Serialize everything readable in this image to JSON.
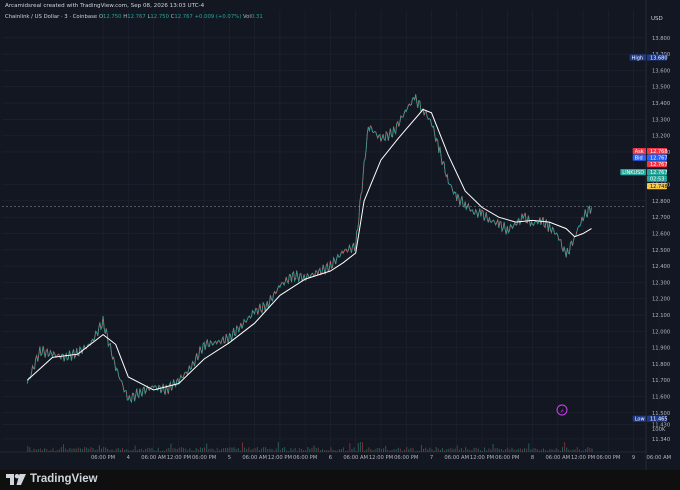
{
  "header": {
    "credit": "Arcamidsreal created with TradingView.com, Sep 08, 2026 13:03 UTC-4",
    "symbol_line": "Chainlink / US Dollar · 3 · Coinbase",
    "o_label": "O",
    "o_value": "12.750",
    "h_label": "H",
    "h_value": "12.767",
    "l_label": "L",
    "l_value": "12.750",
    "c_label": "C",
    "c_value": "12.767",
    "change": "+0.009 (+0.07%)",
    "vol_label": "Vol",
    "vol_value": "0.31"
  },
  "price_axis": {
    "currency": "USD",
    "ticks": [
      "13.800",
      "13.700",
      "13.600",
      "13.500",
      "13.400",
      "13.300",
      "13.200",
      "13.100",
      "12.900",
      "12.800",
      "12.700",
      "12.600",
      "12.500",
      "12.400",
      "12.300",
      "12.200",
      "12.100",
      "12.000",
      "11.900",
      "11.800",
      "11.700",
      "11.600",
      "11.500",
      "11.430",
      "11.340"
    ],
    "volume_label": "100K",
    "markers": [
      {
        "label": "High",
        "value": "13.680",
        "color": "#1e3a8a"
      },
      {
        "label": "Ask",
        "value": "12.768",
        "color": "#f23645"
      },
      {
        "label": "Bid",
        "value": "12.767",
        "color": "#2962ff"
      },
      {
        "label": "",
        "value": "12.767",
        "color": "#f23645"
      },
      {
        "label": "LINKUSD",
        "value": "12.767",
        "color": "#26a69a"
      },
      {
        "label": "",
        "value": "02:53",
        "color": "#26a69a"
      },
      {
        "label": "",
        "value": "12.748",
        "color": "#f7c948"
      },
      {
        "label": "Low",
        "value": "11.465",
        "color": "#1e3a8a"
      }
    ]
  },
  "time_axis": {
    "labels": [
      "06:00 PM",
      "4",
      "06:00 AM",
      "12:00 PM",
      "06:00 PM",
      "5",
      "06:00 AM",
      "12:00 PM",
      "06:00 PM",
      "6",
      "06:00 AM",
      "12:00 PM",
      "06:00 PM",
      "7",
      "06:00 AM",
      "12:00 PM",
      "06:00 PM",
      "8",
      "06:00 AM",
      "12:00 PM",
      "06:00 PM",
      "9",
      "06:00 AM"
    ]
  },
  "chart_data": {
    "type": "line",
    "title": "Chainlink / US Dollar · 3 · Coinbase",
    "ylim": [
      11.26,
      13.86
    ],
    "x_label_times": [
      18,
      24,
      30,
      36,
      42,
      48,
      54,
      60,
      66,
      72,
      78,
      84,
      90,
      96,
      102,
      108,
      114,
      120,
      126,
      132,
      138,
      144,
      150
    ],
    "price_series": {
      "name": "LINKUSD",
      "x_hours": [
        0,
        3,
        6,
        9,
        12,
        15,
        18,
        21,
        24,
        27,
        30,
        33,
        36,
        39,
        42,
        45,
        48,
        51,
        54,
        57,
        60,
        63,
        66,
        69,
        72,
        75,
        78,
        81,
        84,
        87,
        90,
        92,
        94,
        96,
        98,
        100,
        102,
        104,
        106,
        108,
        110,
        112,
        114,
        116,
        118,
        120,
        122,
        124,
        126,
        128,
        130,
        132,
        134
      ],
      "values": [
        11.68,
        11.88,
        11.86,
        11.84,
        11.87,
        11.92,
        12.06,
        11.78,
        11.58,
        11.63,
        11.66,
        11.64,
        11.7,
        11.78,
        11.92,
        11.93,
        11.96,
        12.04,
        12.12,
        12.16,
        12.28,
        12.34,
        12.33,
        12.36,
        12.4,
        12.49,
        12.52,
        13.26,
        13.18,
        13.22,
        13.36,
        13.43,
        13.36,
        13.28,
        13.1,
        12.92,
        12.82,
        12.78,
        12.73,
        12.72,
        12.68,
        12.66,
        12.62,
        12.66,
        12.7,
        12.66,
        12.68,
        12.64,
        12.59,
        12.46,
        12.58,
        12.7,
        12.76
      ]
    },
    "ma_series": {
      "name": "MA",
      "x_hours": [
        0,
        6,
        12,
        18,
        21,
        24,
        30,
        36,
        42,
        48,
        54,
        60,
        66,
        72,
        75,
        78,
        80,
        84,
        88,
        90,
        94,
        96,
        100,
        104,
        108,
        112,
        116,
        120,
        124,
        128,
        130,
        132,
        134
      ],
      "values": [
        11.7,
        11.84,
        11.86,
        11.98,
        11.92,
        11.72,
        11.64,
        11.68,
        11.83,
        11.93,
        12.05,
        12.22,
        12.32,
        12.37,
        12.42,
        12.48,
        12.8,
        13.05,
        13.18,
        13.24,
        13.36,
        13.34,
        13.08,
        12.86,
        12.76,
        12.7,
        12.67,
        12.68,
        12.67,
        12.63,
        12.58,
        12.6,
        12.63
      ]
    },
    "volume_label": "100K",
    "grid": true,
    "legend": "none"
  },
  "footer": {
    "brand": "TradingView"
  }
}
